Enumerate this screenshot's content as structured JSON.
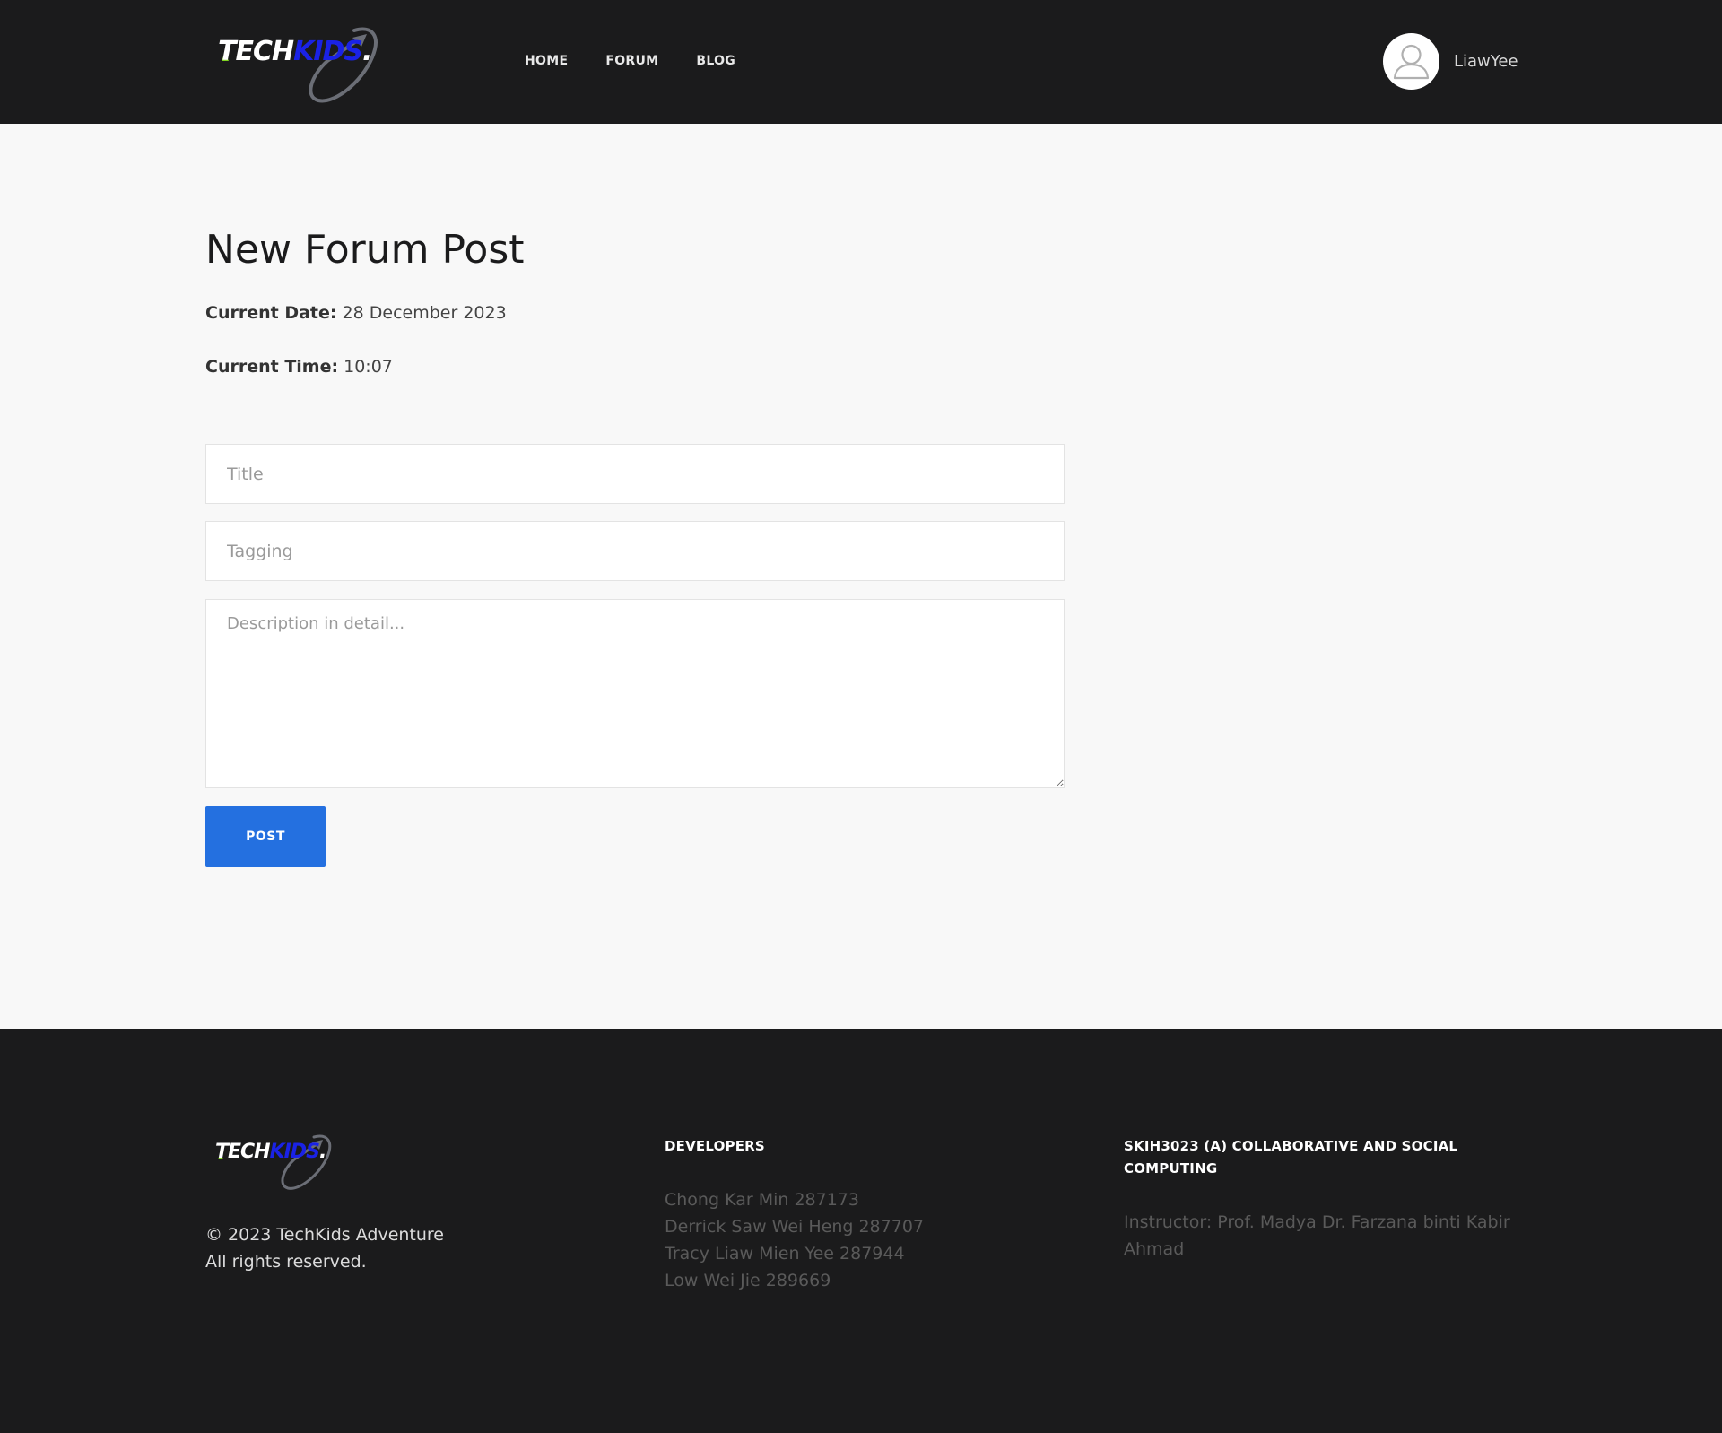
{
  "brand": {
    "logo_parts": [
      "TECH",
      "KIDS",
      "."
    ]
  },
  "nav": {
    "items": [
      {
        "label": "HOME"
      },
      {
        "label": "FORUM"
      },
      {
        "label": "BLOG"
      }
    ]
  },
  "user": {
    "name": "LiawYee"
  },
  "main": {
    "title": "New Forum Post",
    "date_label": "Current Date:",
    "date_value": "28 December 2023",
    "time_label": "Current Time:",
    "time_value": "10:07"
  },
  "form": {
    "title_placeholder": "Title",
    "tag_placeholder": "Tagging",
    "desc_placeholder": "Description in detail...",
    "submit_label": "POST"
  },
  "footer": {
    "copyright_line1": "© 2023 TechKids Adventure",
    "copyright_line2": "All rights reserved.",
    "developers_heading": "DEVELOPERS",
    "developers": [
      "Chong Kar Min 287173",
      "Derrick Saw Wei Heng 287707",
      "Tracy Liaw Mien Yee 287944",
      "Low Wei Jie 289669"
    ],
    "course_heading": "SKIH3023 (A) COLLABORATIVE AND SOCIAL COMPUTING",
    "instructor": "Instructor: Prof. Madya Dr. Farzana binti Kabir Ahmad"
  },
  "colors": {
    "header_bg": "#1b1b1c",
    "page_bg": "#f8f8f8",
    "accent": "#2470e0",
    "logo_blue": "#1a22e6",
    "logo_green": "#7fd321"
  },
  "icons": {
    "avatar": "user-silhouette-icon",
    "logo_swoosh": "orbit-arrow-icon"
  }
}
